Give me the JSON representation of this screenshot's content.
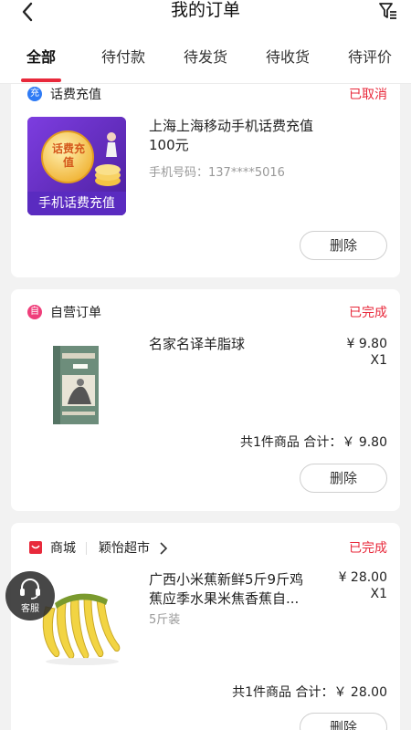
{
  "header": {
    "title": "我的订单",
    "back_icon": "back-chevron-icon",
    "filter_icon": "filter-icon"
  },
  "tabs": [
    {
      "label": "全部",
      "active": true
    },
    {
      "label": "待付款",
      "active": false
    },
    {
      "label": "待发货",
      "active": false
    },
    {
      "label": "待收货",
      "active": false
    },
    {
      "label": "待评价",
      "active": false
    }
  ],
  "orders": [
    {
      "store_icon_text": "充",
      "store": "话费充值",
      "status": "已取消",
      "product": "上海上海移动手机话费充值100元",
      "phone": "手机号码：137****5016",
      "thumb_badge": "话费充值",
      "thumb_caption": "手机话费充值",
      "action": "删除"
    },
    {
      "store_icon_text": "自",
      "store": "自营订单",
      "status": "已完成",
      "product": "名家名译羊脂球",
      "price": "¥ 9.80",
      "qty": "X1",
      "total": "共1件商品 合计：￥ 9.80",
      "action": "删除"
    },
    {
      "store": "商城",
      "sub_store": "颖怡超市",
      "status": "已完成",
      "product": "广西小米蕉新鲜5斤9斤鸡蕉应季水果米焦香蕉自...",
      "spec": "5斤装",
      "price": "¥ 28.00",
      "qty": "X1",
      "total": "共1件商品 合计：￥ 28.00",
      "action": "删除"
    }
  ],
  "customer_service": {
    "label": "客服"
  },
  "colors": {
    "accent": "#e8293b",
    "recharge_icon": "#2f7bf5",
    "self_icon": "#ef3e7a"
  }
}
